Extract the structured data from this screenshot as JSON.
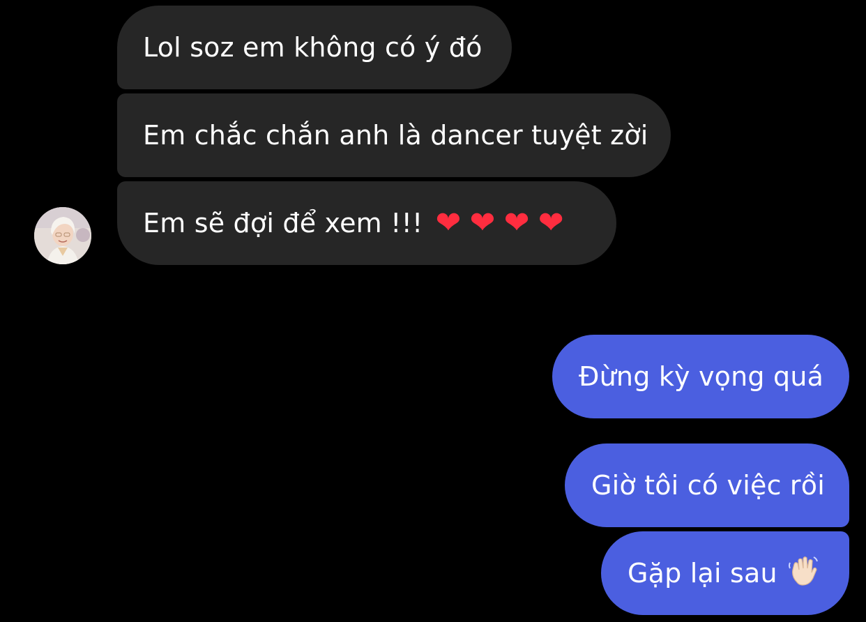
{
  "messages": {
    "incoming": [
      {
        "text": "Lol soz em không có ý đó"
      },
      {
        "text": "Em chắc chắn anh là dancer tuyệt zời"
      },
      {
        "text": "Em sẽ đợi để xem !!!",
        "emoji": [
          "❤",
          "❤",
          "❤",
          "❤"
        ]
      }
    ],
    "outgoing": [
      {
        "text": "Đừng kỳ vọng quá"
      },
      {
        "text": "Giờ tôi có việc rồi"
      },
      {
        "text": "Gặp lại sau",
        "emoji": "👋"
      }
    ]
  },
  "colors": {
    "background": "#000000",
    "incoming_bubble": "#262626",
    "outgoing_bubble": "#4b5fe0",
    "heart": "#ff2d3f"
  },
  "icons": {
    "avatar": "profile-photo",
    "heart": "heart-emoji",
    "wave": "waving-hand-emoji"
  }
}
